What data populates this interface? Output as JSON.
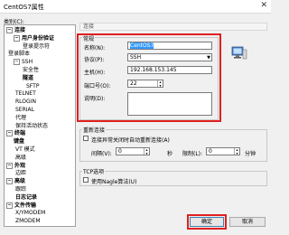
{
  "window": {
    "title": "CentOS7属性",
    "close": "✕"
  },
  "category_label": "类别(C):",
  "tree": [
    {
      "label": "连接",
      "bold": true,
      "toggle": "−"
    },
    {
      "label": "用户身份验证",
      "bold": true,
      "toggle": "−"
    },
    {
      "label": "登录提示符",
      "bold": false,
      "toggle": ""
    },
    {
      "label": "登录脚本",
      "bold": false,
      "toggle": ""
    },
    {
      "label": "SSH",
      "bold": false,
      "toggle": "−"
    },
    {
      "label": "安全性",
      "bold": false,
      "toggle": ""
    },
    {
      "label": "隧道",
      "bold": true,
      "toggle": ""
    },
    {
      "label": "SFTP",
      "bold": false,
      "toggle": ""
    },
    {
      "label": "TELNET",
      "bold": false,
      "toggle": ""
    },
    {
      "label": "RLOGIN",
      "bold": false,
      "toggle": ""
    },
    {
      "label": "SERIAL",
      "bold": false,
      "toggle": ""
    },
    {
      "label": "代理",
      "bold": false,
      "toggle": ""
    },
    {
      "label": "保持活动状态",
      "bold": false,
      "toggle": ""
    },
    {
      "label": "终端",
      "bold": true,
      "toggle": "−"
    },
    {
      "label": "键盘",
      "bold": true,
      "toggle": ""
    },
    {
      "label": "VT 模式",
      "bold": false,
      "toggle": ""
    },
    {
      "label": "高级",
      "bold": false,
      "toggle": ""
    },
    {
      "label": "外观",
      "bold": true,
      "toggle": "−"
    },
    {
      "label": "边距",
      "bold": false,
      "toggle": ""
    },
    {
      "label": "高级",
      "bold": true,
      "toggle": "−"
    },
    {
      "label": "跟踪",
      "bold": false,
      "toggle": ""
    },
    {
      "label": "日志记录",
      "bold": true,
      "toggle": ""
    },
    {
      "label": "文件传输",
      "bold": true,
      "toggle": "−"
    },
    {
      "label": "X/YMODEM",
      "bold": false,
      "toggle": ""
    },
    {
      "label": "ZMODEM",
      "bold": false,
      "toggle": ""
    }
  ],
  "section_header": "连接",
  "general": {
    "legend": "常规",
    "name_label": "名称(N):",
    "name_value": "CentOS7",
    "protocol_label": "协议(P):",
    "protocol_value": "SSH",
    "host_label": "主机(H):",
    "host_value": "192.168.153.145",
    "port_label": "端口号(O):",
    "port_value": "22",
    "desc_label": "说明(D):",
    "desc_value": ""
  },
  "reconnect": {
    "legend": "重新连接",
    "auto_label": "连接异常关闭时自动重新连接(A)",
    "interval_label": "间隔(V):",
    "interval_value": "0",
    "seconds_unit": "秒",
    "limit_label": "限制(L):",
    "limit_value": "0",
    "minutes_unit": "分钟"
  },
  "tcp": {
    "legend": "TCP选项",
    "nagle_label": "使用Nagle算法(U)"
  },
  "buttons": {
    "ok": "确定",
    "cancel": "取消"
  },
  "accent_color": "#e02020"
}
